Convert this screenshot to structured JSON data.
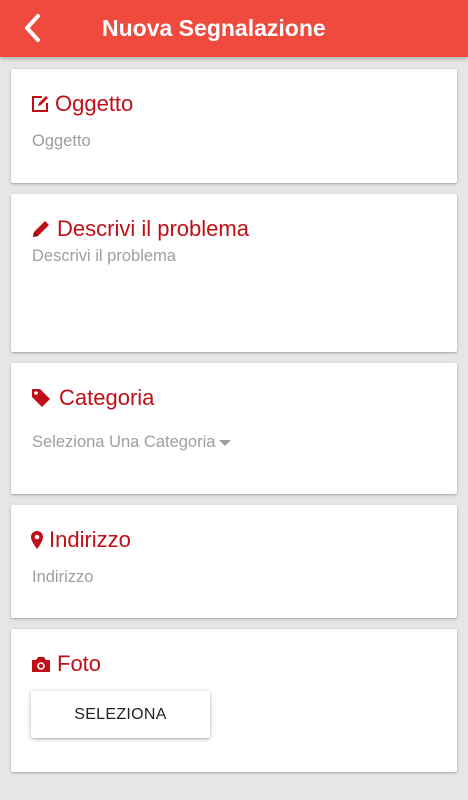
{
  "appbar": {
    "title": "Nuova Segnalazione",
    "back_icon": "chevron-left-icon",
    "background_color": "#f04a3f"
  },
  "accent_color": "#c00f17",
  "cards": {
    "oggetto": {
      "title": "Oggetto",
      "icon": "edit-icon",
      "placeholder": "Oggetto",
      "value": ""
    },
    "descrizione": {
      "title": "Descrivi il problema",
      "icon": "pencil-icon",
      "placeholder": "Descrivi il problema",
      "value": ""
    },
    "categoria": {
      "title": "Categoria",
      "icon": "tag-icon",
      "selected": "Seleziona Una Categoria"
    },
    "indirizzo": {
      "title": "Indirizzo",
      "icon": "map-marker-icon",
      "placeholder": "Indirizzo",
      "value": ""
    },
    "foto": {
      "title": "Foto",
      "icon": "camera-icon",
      "button_label": "SELEZIONA"
    }
  }
}
